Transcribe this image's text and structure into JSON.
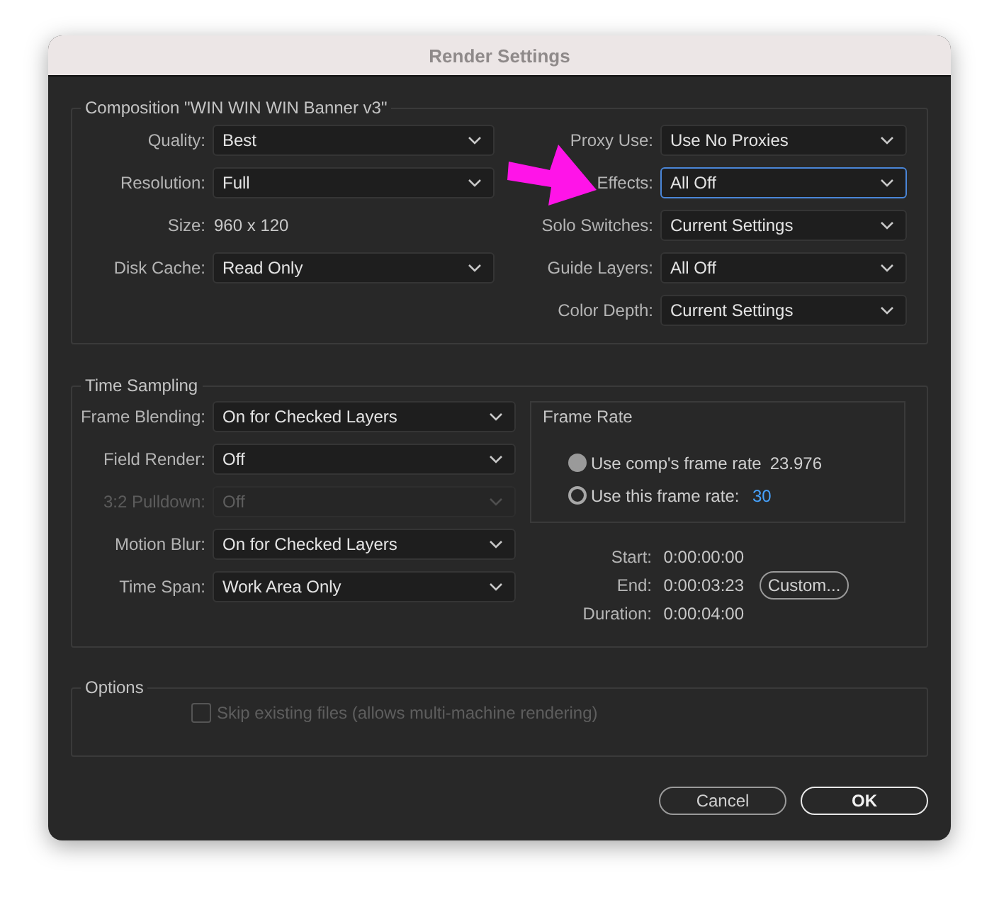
{
  "window": {
    "title": "Render Settings"
  },
  "composition": {
    "title": "Composition \"WIN WIN WIN Banner v3\"",
    "left_fields": [
      {
        "kind": "dropdown",
        "label": "Quality:",
        "value": "Best",
        "focused": false,
        "disabled": false
      },
      {
        "kind": "dropdown",
        "label": "Resolution:",
        "value": "Full",
        "focused": false,
        "disabled": false
      },
      {
        "kind": "text",
        "label": "Size:",
        "value": "960 x 120"
      },
      {
        "kind": "dropdown",
        "label": "Disk Cache:",
        "value": "Read Only",
        "focused": false,
        "disabled": false
      }
    ],
    "right_fields": [
      {
        "kind": "dropdown",
        "label": "Proxy Use:",
        "value": "Use No Proxies",
        "focused": false,
        "disabled": false
      },
      {
        "kind": "dropdown",
        "label": "Effects:",
        "value": "All Off",
        "focused": true,
        "disabled": false
      },
      {
        "kind": "dropdown",
        "label": "Solo Switches:",
        "value": "Current Settings",
        "focused": false,
        "disabled": false
      },
      {
        "kind": "dropdown",
        "label": "Guide Layers:",
        "value": "All Off",
        "focused": false,
        "disabled": false
      },
      {
        "kind": "dropdown",
        "label": "Color Depth:",
        "value": "Current Settings",
        "focused": false,
        "disabled": false
      }
    ]
  },
  "time_sampling": {
    "title": "Time Sampling",
    "fields": [
      {
        "kind": "dropdown",
        "label": "Frame Blending:",
        "value": "On for Checked Layers",
        "focused": false,
        "disabled": false
      },
      {
        "kind": "dropdown",
        "label": "Field Render:",
        "value": "Off",
        "focused": false,
        "disabled": false
      },
      {
        "kind": "dropdown",
        "label": "3:2 Pulldown:",
        "value": "Off",
        "focused": false,
        "disabled": true
      },
      {
        "kind": "dropdown",
        "label": "Motion Blur:",
        "value": "On for Checked Layers",
        "focused": false,
        "disabled": false
      },
      {
        "kind": "dropdown",
        "label": "Time Span:",
        "value": "Work Area Only",
        "focused": false,
        "disabled": false
      }
    ],
    "frame_rate": {
      "title": "Frame Rate",
      "options": [
        {
          "label": "Use comp's frame rate",
          "value": "23.976",
          "kind": "fixed",
          "selected": true
        },
        {
          "label": "Use this frame rate:",
          "value": "30",
          "kind": "input",
          "selected": false
        }
      ]
    },
    "times": [
      {
        "label": "Start:",
        "value": "0:00:00:00"
      },
      {
        "label": "End:",
        "value": "0:00:03:23",
        "button": "Custom..."
      },
      {
        "label": "Duration:",
        "value": "0:00:04:00"
      }
    ]
  },
  "options": {
    "title": "Options",
    "checkbox": {
      "label": "Skip existing files (allows multi-machine rendering)",
      "checked": false,
      "disabled": true
    }
  },
  "buttons": [
    {
      "label": "Cancel",
      "kind": "secondary"
    },
    {
      "label": "OK",
      "kind": "primary"
    }
  ]
}
